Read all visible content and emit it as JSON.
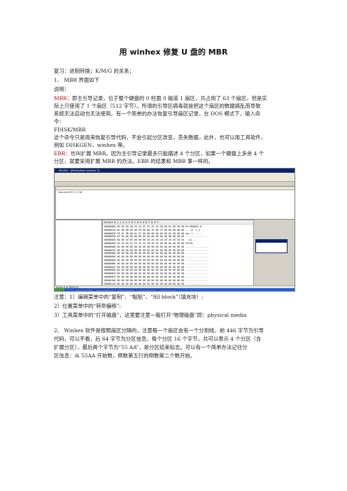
{
  "title": "用 winhex 修复 U 盘的 MBR",
  "lines": {
    "l1": "复习：进制转换；K/M/G 的关系；",
    "l2": "1、 MBR 界面如下",
    "l3": "说明：",
    "l4_red": "MBR：",
    "l4": "即主引导记录，位于整个硬盘的 0 柱面 0 磁道 1 扇区，共占用了 63 个扇区，但是实",
    "l5": "际上只使用了 1 个扇区（512 字节）。所谓的引导区病毒就是把这个扇区的数据搞乱而导致",
    "l6": "系统无法启动也无法使用。有一个简单的办法恢复引导扇区记录，在 DOS 模式下，输入命",
    "l7": "令：",
    "l8": "FDISK/MBR",
    "l9": "这个命令只是用来恢复引导代码，不会引起分区改变，丢失数据，此外，也可以用工具软件，",
    "l10": "例如 DISKGEN，winhex 等。",
    "l11_red": "EBR：",
    "l11": "也叫扩展 MBR。因为主引导记录最多只能描述 4 个分区，如果一个硬盘上多余 4 个",
    "l12": "分区，就要采用扩展 MBR 的办法。EBR 的结果和 MBR 事一样的。",
    "n1": "注意：1）编辑菜单中的“复制”、“黏贴”、“fill block”（填充块）;",
    "n2": "2）位置菜单中的“转到偏移”;",
    "n3": "3）工具菜单中的“打开磁盘”，这里要注意一般打开“物理磁盘”即：physical media",
    "p2a": "2、 Winhex 软件是按照扇区分隔的，注意每一个扇区会有一个分割线，前 446 字节为引导",
    "p2b": "代码，可以不看，后 64 字节为分区信息，每个分区 16 个字节，共可以表示 4 个分区（含",
    "p2c": "扩展分区），最后两个字节为“55 AA”，是分区结束标志。可以有一个简单办法记住分",
    "p2d": "区信息：从 55AA 开始数，倒数第五行的倒数第二个数开始。"
  },
  "screenshot": {
    "window_title": "WinHex - [Removable medium 1]",
    "hex_header": "Offset    0  1  2  3  4  5  6  7   8  9  A  B  C  D  E  F",
    "rows": [
      "00000000  EB 58 90 4D 53 44 4F 53  35 2E 30 00 02 08 38 00  ëX.MSDOS5.0..",
      "00000010  02 00 00 00 00 F8 00 00  3F 00 FF 00 00 00 00 00  ....ø..?.ÿ",
      "00000020  78 67 3B 00 6C 07 00 00  00 00 00 00 02 00 00 00  xg;.l.......",
      "00000030  01 00 06 00 00 00 00 00  00 00 00 00 00 00 00 00  ................",
      "00000040  80 00 29 6F 00 00 00 20  20 20 20 20 20 20 20 20  ..)o...",
      "00000050  20 20 46 41 54 33 32 20  20 20 00 00 00 00 00 00    FAT32",
      "00000060  00 00 00 00 00 00 00 00  00 00 00 00 00 00 00 00  ................",
      "00000070  00 00 00 00 00 00 00 00  00 00 00 00 00 00 00 00  ................",
      "00000080  00 00 00 00 00 00 00 00  00 00 00 00 00 00 00 00  ................",
      "00000090  00 00 00 00 00 00 00 00  00 00 00 00 00 00 00 00  ................",
      "000000A0  00 00 00 00 00 00 00 00  00 00 00 00 00 00 00 00  ................",
      "000000B0  00 00 00 00 00 00 00 00  00 00 00 00 00 00 00 00  ................",
      "000000C0  00 00 00 00 00 00 00 00  00 00 00 00 00 00 00 00  ................",
      "000000D0  00 00 00 00 00 00 00 00  00 00 00 00 00 00 00 00  ................",
      "000000E0  00 00 00 00 00 00 00 00  00 00 00 00 00 00 00 00  ................",
      "000000F0  00 00 00 00 00 00 00 00  00 00 00 00 00 00 00 00  ................",
      "00000100  00 00 00 00 00 00 00 00  00 00 00 00 00 00 00 00  ................",
      "00000110  00 00 00 00 00 00 00 00  00 00 00 00 00 00 00 00  ................"
    ],
    "file_entry": "\\Volume   FAT   3.7 GB",
    "status": "Sector 0 of 7800112"
  }
}
